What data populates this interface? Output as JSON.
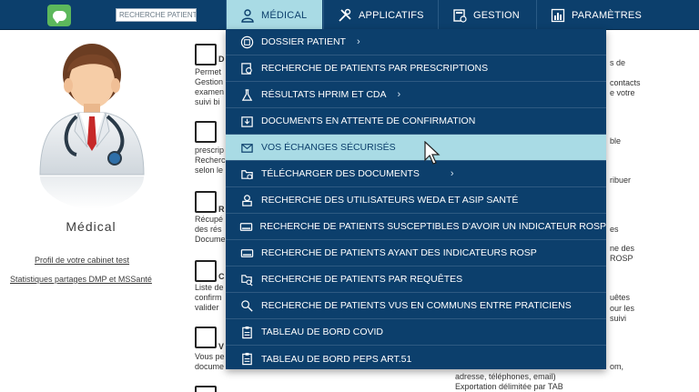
{
  "header": {
    "search_placeholder": "RECHERCHE PATIENT",
    "tabs": [
      {
        "label": "MÉDICAL",
        "icon": "user-doctor-icon",
        "active": true
      },
      {
        "label": "APPLICATIFS",
        "icon": "tools-icon",
        "active": false
      },
      {
        "label": "GESTION",
        "icon": "calculator-icon",
        "active": false
      },
      {
        "label": "PARAMÈTRES",
        "icon": "chart-icon",
        "active": false
      }
    ]
  },
  "left": {
    "title": "Médical",
    "links": [
      "Profil de votre cabinet test",
      "Statistiques partages DMP et MSSanté"
    ]
  },
  "menu": {
    "items": [
      {
        "label": "DOSSIER PATIENT",
        "icon": "folder-icon",
        "chevron": "›"
      },
      {
        "label": "RECHERCHE DE PATIENTS PAR PRESCRIPTIONS",
        "icon": "search-doc-icon"
      },
      {
        "label": "RÉSULTATS HPRIM ET CDA",
        "icon": "flask-icon",
        "chevron": "›"
      },
      {
        "label": "DOCUMENTS EN ATTENTE DE CONFIRMATION",
        "icon": "inbox-icon"
      },
      {
        "label": "VOS ÉCHANGES SÉCURISÉS",
        "icon": "envelope-icon"
      },
      {
        "label": "TÉLÉCHARGER DES DOCUMENTS",
        "icon": "download-folder-icon",
        "chevron": "›"
      },
      {
        "label": "RECHERCHE DES UTILISATEURS WEDA ET ASIP SANTÉ",
        "icon": "user-badge-icon"
      },
      {
        "label": "RECHERCHE DE PATIENTS SUSCEPTIBLES D'AVOIR UN INDICATEUR ROSP",
        "icon": "card-icon"
      },
      {
        "label": "RECHERCHE DE PATIENTS AYANT DES INDICATEURS ROSP",
        "icon": "card-icon"
      },
      {
        "label": "RECHERCHE DE PATIENTS PAR REQUÊTES",
        "icon": "search-folder-icon"
      },
      {
        "label": "RECHERCHE DE PATIENTS VUS EN COMMUNS ENTRE PRATICIENS",
        "icon": "users-search-icon"
      },
      {
        "label": "TABLEAU DE BORD COVID",
        "icon": "clipboard-icon"
      },
      {
        "label": "TABLEAU DE BORD PEPS ART.51",
        "icon": "clipboard-icon"
      }
    ]
  },
  "background": {
    "texts": [
      "D",
      "Permet",
      "Gestion",
      "examen",
      "suivi bi",
      "prescrip",
      "Recherc",
      "selon le",
      "R",
      "Récupé",
      "des rés",
      "Docume",
      "C",
      "Liste de",
      "confirm",
      "valider",
      "V",
      "Vous pe",
      "docume",
      "s de",
      "contacts",
      "e votre",
      "ble",
      "ribuer",
      "es",
      "ne des",
      "ROSP",
      "uêtes",
      "our les",
      "suivi",
      "om,",
      "adresse, téléphones, email)",
      "Exportation délimitée par TAB"
    ]
  }
}
